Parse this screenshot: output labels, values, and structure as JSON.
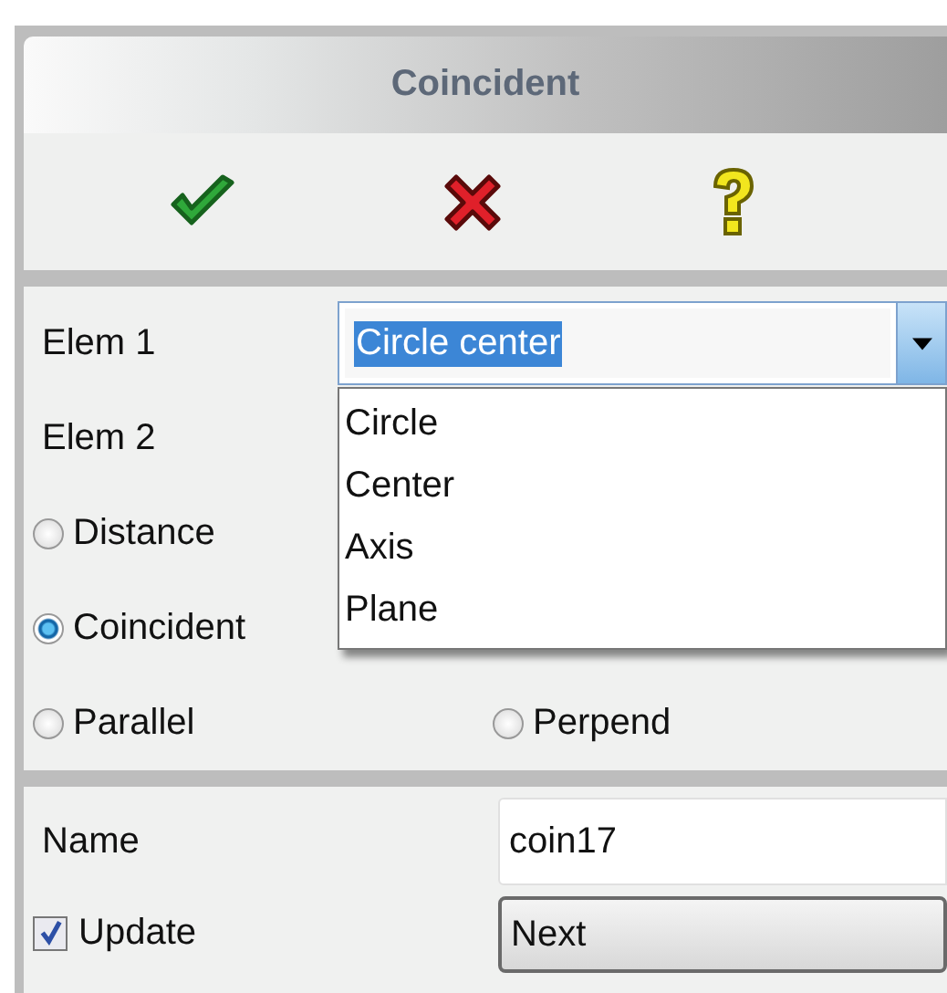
{
  "title": "Coincident",
  "elem1": {
    "label": "Elem 1",
    "value": "Circle center",
    "expanded": true,
    "options": [
      {
        "label": "Circle",
        "selected": false
      },
      {
        "label": "Center",
        "selected": false
      },
      {
        "label": "Axis",
        "selected": false
      },
      {
        "label": "Plane",
        "selected": false
      }
    ]
  },
  "elem2": {
    "label": "Elem 2"
  },
  "radio_rows": [
    [
      {
        "label": "Distance",
        "selected": false
      }
    ],
    [
      {
        "label": "Coincident",
        "selected": true
      }
    ],
    [
      {
        "label": "Parallel",
        "selected": false
      },
      {
        "label": "Perpend",
        "selected": false
      }
    ]
  ],
  "name": {
    "label": "Name",
    "value": "coin17"
  },
  "update": {
    "label": "Update",
    "checked": true
  },
  "next_button": "Next"
}
